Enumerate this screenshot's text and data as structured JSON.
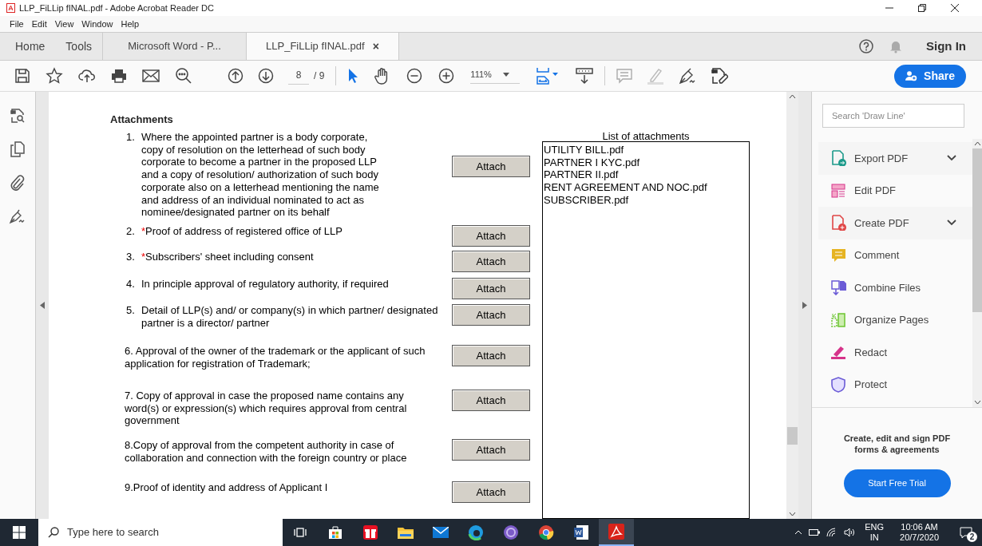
{
  "window": {
    "title": "LLP_FiLLip fINAL.pdf - Adobe Acrobat Reader DC"
  },
  "menu": [
    "File",
    "Edit",
    "View",
    "Window",
    "Help"
  ],
  "tabs": [
    {
      "label": "Home",
      "kind": "nav",
      "selected": false
    },
    {
      "label": "Tools",
      "kind": "nav",
      "selected": false
    },
    {
      "label": "Microsoft Word - P...",
      "kind": "doc",
      "selected": false
    },
    {
      "label": "LLP_FiLLip fINAL.pdf",
      "kind": "doc",
      "selected": true,
      "close": "×"
    }
  ],
  "sign_in": "Sign In",
  "toolbar": {
    "page": "8",
    "page_total": "/ 9",
    "zoom": "111%",
    "share": "Share"
  },
  "document": {
    "heading": "Attachments",
    "list_title": "List of attachments",
    "items": [
      {
        "number": "1.",
        "button": "Attach",
        "lines": [
          "Where the appointed partner is a body corporate,",
          "copy of resolution on the letterhead of such body",
          "corporate to become a partner in the proposed LLP",
          "and a copy of  resolution/ authorization of such body",
          "corporate also on a letterhead mentioning the name",
          "and address of an individual nominated to act as",
          "nominee/designated partner on its behalf"
        ]
      },
      {
        "number": "2.",
        "marker": "*",
        "button": "Attach",
        "lines": [
          "Proof of address of registered office of LLP"
        ]
      },
      {
        "number": "3.",
        "marker": "*",
        "button": "Attach",
        "lines": [
          "Subscribers' sheet including consent"
        ]
      },
      {
        "number": "4.",
        "button": "Attach",
        "lines": [
          "In principle approval of regulatory authority, if required"
        ]
      },
      {
        "number": "5.",
        "button": "Attach",
        "lines": [
          "Detail of LLP(s) and/ or company(s) in which partner/ designated",
          "partner is a director/ partner"
        ]
      },
      {
        "button": "Attach",
        "lines": [
          "6. Approval of the owner of the trademark or the applicant of such",
          "application for registration of Trademark;"
        ]
      },
      {
        "button": "Attach",
        "lines": [
          "7. Copy of approval in case the proposed name contains any",
          "word(s) or expression(s) which requires approval from central",
          "government"
        ]
      },
      {
        "button": "Attach",
        "lines": [
          "8.Copy of approval from the competent authority in case of",
          "collaboration and connection with the foreign country or place"
        ]
      },
      {
        "button": "Attach",
        "lines": [
          "9.Proof of identity and address of Applicant I"
        ]
      }
    ],
    "attachments": [
      "UTILITY BILL.pdf",
      "PARTNER I KYC.pdf",
      "PARTNER II.pdf",
      "RENT AGREEMENT AND NOC.pdf",
      "SUBSCRIBER.pdf"
    ]
  },
  "tools_pane": {
    "search": {
      "placeholder": "Search 'Draw Line'"
    },
    "tools": [
      {
        "label": "Export PDF",
        "kind": "export",
        "expandable": true
      },
      {
        "label": "Edit PDF",
        "kind": "edit",
        "expandable": false
      },
      {
        "label": "Create PDF",
        "kind": "create",
        "expandable": true
      },
      {
        "label": "Comment",
        "kind": "comment",
        "expandable": false
      },
      {
        "label": "Combine Files",
        "kind": "combine",
        "expandable": false
      },
      {
        "label": "Organize Pages",
        "kind": "organize",
        "expandable": false
      },
      {
        "label": "Redact",
        "kind": "redact",
        "expandable": false
      },
      {
        "label": "Protect",
        "kind": "protect",
        "expandable": false
      }
    ],
    "promo": "Create, edit and sign PDF forms & agreements",
    "trial": "Start Free Trial"
  },
  "taskbar": {
    "search": {
      "placeholder": "Type here to search"
    },
    "language": "ENG",
    "region": "IN",
    "time": "10:06 AM",
    "date": "20/7/2020",
    "notifications": "2"
  }
}
